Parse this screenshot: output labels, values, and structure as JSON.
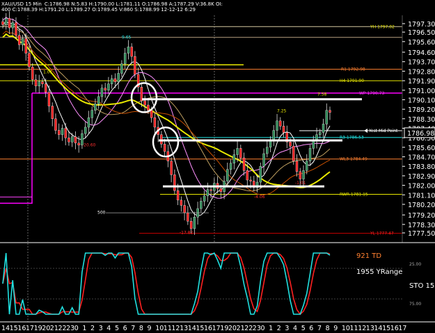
{
  "header": {
    "symbol": "XAU/USD  15 Min",
    "ohlc": "C:1786.98  N:5.83  H:1790.00  L:1781.11  O:1786.98  A:1787.29  V:36.8K  OI:",
    "subline": "400  C:1788.39  H:1791.20  L:1789.27  O:1789.45  V:860  S:1788.99  12-12-12  6:29"
  },
  "colors": {
    "background": "#000000",
    "up_candle": "#2e8b57",
    "down_candle": "#ff2020",
    "yellow_ma": "#e8e800",
    "pink_ma": "#ff90ff",
    "white_ma": "#ffffff",
    "magenta_line": "#ff00ff",
    "orange_line": "#c85000",
    "cyan_stoch": "#20e0e0",
    "red_stoch": "#ff2020",
    "td_color": "#ff8030"
  },
  "chart_data": {
    "type": "candlestick",
    "y_ticks": [
      "1797.30",
      "1796.50",
      "1795.60",
      "1794.60",
      "1793.70",
      "1792.80",
      "1791.90",
      "1791.00",
      "1790.10",
      "1789.20",
      "1788.30",
      "1787.40",
      "1786.50",
      "1785.60",
      "1784.70",
      "1783.80",
      "1782.90",
      "1782.00",
      "1781.10",
      "1780.20",
      "1779.20",
      "1778.30",
      "1777.50"
    ],
    "ylim": [
      1777.1,
      1798.0
    ],
    "current_price": "1786.98",
    "x_ticks": [
      "14",
      "15",
      "16",
      "17",
      "19",
      "20",
      "21",
      "22",
      "23",
      "0",
      "1",
      "2",
      "3",
      "4",
      "5",
      "6",
      "7",
      "8",
      "9",
      "10",
      "11",
      "12",
      "13",
      "14",
      "15",
      "16",
      "17",
      "19",
      "20",
      "21",
      "22",
      "23",
      "0",
      "1",
      "2",
      "3",
      "4",
      "5",
      "6",
      "7",
      "8",
      "9",
      "10",
      "11",
      "12",
      "13",
      "14",
      "15",
      "16",
      "17"
    ],
    "closes": [
      1797.2,
      1797.8,
      1796.9,
      1797.4,
      1796.2,
      1795.3,
      1795.9,
      1794.5,
      1793.2,
      1792.0,
      1791.4,
      1791.8,
      1791.6,
      1790.8,
      1789.5,
      1788.3,
      1787.2,
      1786.8,
      1787.4,
      1786.5,
      1786.1,
      1786.6,
      1786.0,
      1785.8,
      1786.9,
      1787.5,
      1788.4,
      1789.1,
      1789.7,
      1790.4,
      1791.2,
      1791.0,
      1791.6,
      1792.1,
      1791.8,
      1792.6,
      1793.5,
      1794.5,
      1795.1,
      1794.2,
      1792.5,
      1791.3,
      1790.0,
      1789.6,
      1789.1,
      1788.4,
      1787.5,
      1786.8,
      1785.9,
      1785.2,
      1784.3,
      1783.0,
      1781.5,
      1780.6,
      1780.1,
      1779.4,
      1778.6,
      1777.9,
      1779.0,
      1779.8,
      1780.5,
      1781.0,
      1781.6,
      1781.5,
      1782.2,
      1781.7,
      1781.4,
      1782.4,
      1783.5,
      1784.1,
      1784.9,
      1785.5,
      1784.6,
      1783.4,
      1782.5,
      1782.4,
      1781.8,
      1782.3,
      1783.8,
      1785.0,
      1785.6,
      1786.3,
      1787.2,
      1788.1,
      1787.6,
      1787.0,
      1786.1,
      1785.7,
      1784.3,
      1783.3,
      1782.6,
      1783.4,
      1784.3,
      1785.5,
      1786.2,
      1786.8,
      1787.0,
      1787.8,
      1789.1,
      1788.9
    ],
    "annotations": [
      {
        "text": "YH 1797.02",
        "price": 1797.02,
        "color": "#e8e800"
      },
      {
        "text": "R1 1792.98",
        "price": 1792.98,
        "color": "#ff8030"
      },
      {
        "text": "H4 1791.90",
        "price": 1791.9,
        "color": "#e8e800"
      },
      {
        "text": "WP 1790.73",
        "price": 1790.73,
        "color": "#ff40ff"
      },
      {
        "text": "R3 1786.53",
        "price": 1786.53,
        "color": "#20e0e0"
      },
      {
        "text": "WL3 1784.49",
        "price": 1784.49,
        "color": "#ff8030"
      },
      {
        "text": "RWR 1781.15",
        "price": 1781.15,
        "color": "#e8e800"
      },
      {
        "text": "YL 1777.47",
        "price": 1777.47,
        "color": "#ff2020"
      },
      {
        "text": "Yest Mid Point",
        "price": 1787.17,
        "color": "#ffffff"
      }
    ],
    "candle_labels": [
      "9.65",
      "1.01",
      "-20.60",
      "7.58",
      "7.25",
      "-1.01",
      "-4.06",
      "-17.82",
      "500"
    ]
  },
  "indicator": {
    "td_label": "921 TD",
    "range_label": "1955 YRange",
    "stoch_label": "STO  15",
    "level_upper": "25.00",
    "level_lower": "75.00"
  }
}
